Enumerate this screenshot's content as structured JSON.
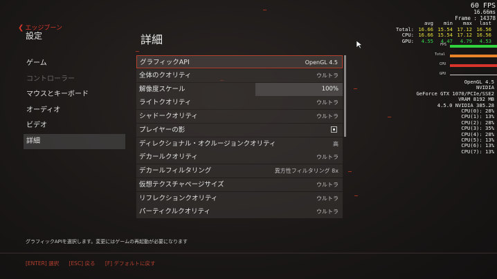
{
  "header": {
    "back_label": "エッジブーン",
    "settings_title": "設定",
    "page_title": "詳細"
  },
  "sidebar": {
    "items": [
      {
        "label": "ゲーム"
      },
      {
        "label": "コントローラー"
      },
      {
        "label": "マウスとキーボード"
      },
      {
        "label": "オーディオ"
      },
      {
        "label": "ビデオ"
      },
      {
        "label": "詳細"
      }
    ]
  },
  "settings": [
    {
      "label": "グラフィックAPI",
      "value": "OpenGL 4.5"
    },
    {
      "label": "全体のクオリティ",
      "value": "ウルトラ"
    },
    {
      "label": "解像度スケール",
      "value": "100%"
    },
    {
      "label": "ライトクオリティ",
      "value": "ウルトラ"
    },
    {
      "label": "シャドークオリティ",
      "value": "ウルトラ"
    },
    {
      "label": "プレイヤーの影",
      "value": ""
    },
    {
      "label": "ディレクショナル・オクルージョンクオリティ",
      "value": "高"
    },
    {
      "label": "デカールクオリティ",
      "value": "ウルトラ"
    },
    {
      "label": "デカールフィルタリング",
      "value": "異方性フィルタリング 8x"
    },
    {
      "label": "仮想テクスチャページサイズ",
      "value": "ウルトラ"
    },
    {
      "label": "リフレクションクオリティ",
      "value": "ウルトラ"
    },
    {
      "label": "パーティクルクオリティ",
      "value": "ウルトラ"
    }
  ],
  "description": "グラフィックAPIを選択します。変更にはゲームの再起動が必要になります",
  "footer": {
    "enter": "[ENTER] 選択",
    "esc": "[ESC] 戻る",
    "f": "[F] デフォルトに戻す"
  },
  "perf": {
    "fps": "60 FPS",
    "frametime": "16.66ms",
    "frame": "Frame : 14378",
    "headers": [
      "avg",
      "min",
      "max",
      "last"
    ],
    "rows": [
      {
        "label": "Total:",
        "values": [
          "16.66",
          "15.54",
          "17.12",
          "16.56"
        ]
      },
      {
        "label": "CPU:",
        "values": [
          "16.66",
          "15.54",
          "17.12",
          "16.56"
        ]
      },
      {
        "label": "GPU:",
        "values": [
          "4.55",
          "4.47",
          "4.79",
          "4.53"
        ]
      }
    ],
    "graphs": [
      {
        "label": "FPS",
        "color": "#2fd23d"
      },
      {
        "label": "Total",
        "color": "#e8832a"
      },
      {
        "label": "CPU",
        "color": "#d8342c"
      },
      {
        "label": "GPU",
        "color": "#cfcfcf"
      }
    ],
    "system": {
      "api": "OpenGL 4.5",
      "vendor": "NVIDIA",
      "gpu": "GeForce GTX 1070/PCIe/SSE2",
      "vram": "VRAM 8192 MB",
      "driver": "4.5.0 NVIDIA 385.28",
      "cpus": [
        "CPU(0):  28%",
        "CPU(1):  13%",
        "CPU(2):  28%",
        "CPU(3):  35%",
        "CPU(4):  28%",
        "CPU(5):  13%",
        "CPU(6):  13%",
        "CPU(7):  13%"
      ]
    }
  },
  "colors": {
    "accent": "#d8382b",
    "selected_border": "#b5422e"
  }
}
